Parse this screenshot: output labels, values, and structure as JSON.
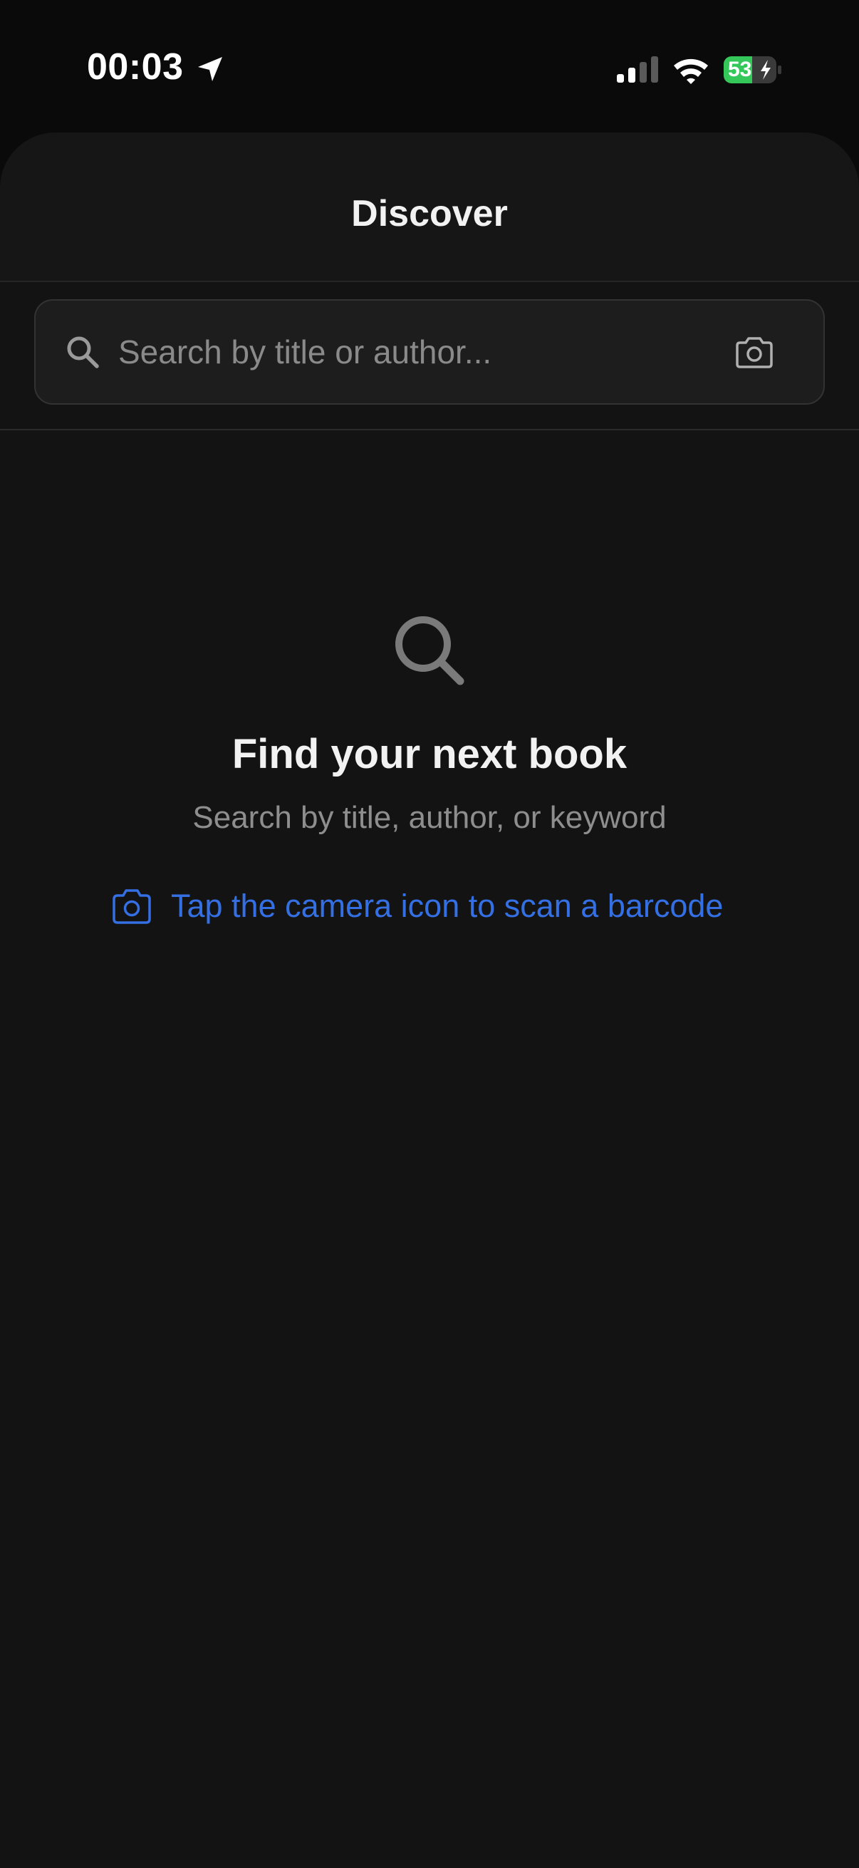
{
  "status_bar": {
    "time": "00:03",
    "battery_level": "53",
    "icons": [
      "location-arrow-icon",
      "cellular-signal-icon",
      "wifi-icon",
      "battery-charging-icon"
    ]
  },
  "header": {
    "title": "Discover"
  },
  "search": {
    "placeholder": "Search by title or author...",
    "value": "",
    "icons": [
      "search-icon",
      "camera-icon"
    ]
  },
  "empty_state": {
    "icon": "magnifier-icon",
    "title": "Find your next book",
    "subtitle": "Search by title, author, or keyword",
    "scan_hint": "Tap the camera icon to scan a barcode"
  },
  "colors": {
    "background": "#131313",
    "header_background": "#161616",
    "accent": "#3470e4",
    "battery_green": "#34c759",
    "muted_text": "#8e8e8e"
  }
}
